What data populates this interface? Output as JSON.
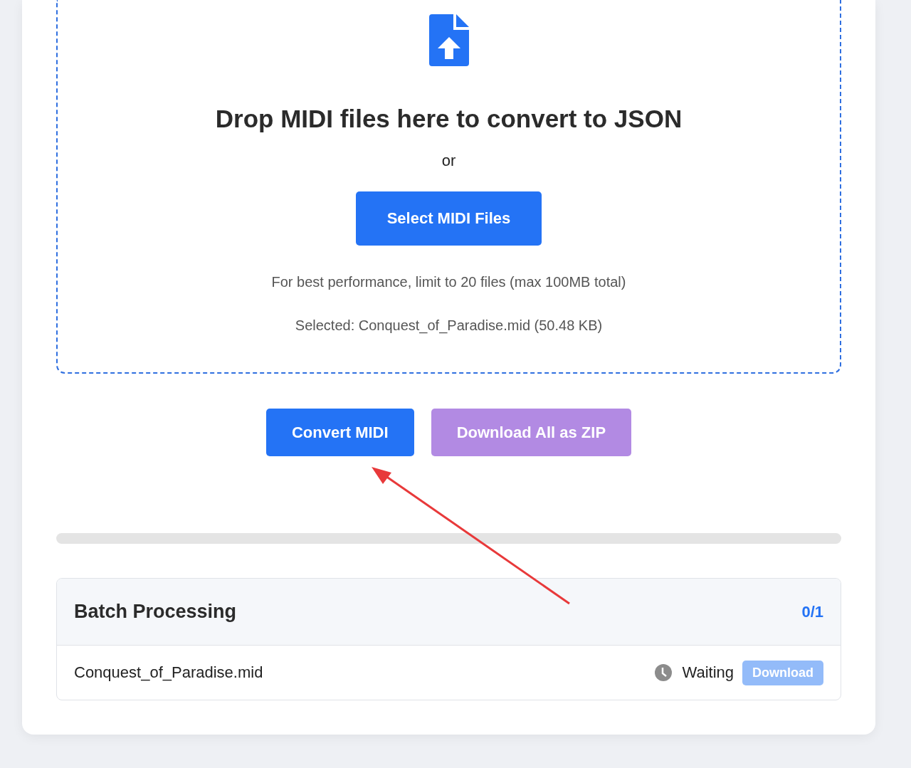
{
  "dropzone": {
    "title": "Drop MIDI files here to convert to JSON",
    "separator": "or",
    "select_button": "Select MIDI Files",
    "hint": "For best performance, limit to 20 files (max 100MB total)",
    "selected": "Selected: Conquest_of_Paradise.mid (50.48 KB)"
  },
  "actions": [
    {
      "label": "Convert MIDI",
      "kind": "primary",
      "disabled": false
    },
    {
      "label": "Download All as ZIP",
      "kind": "zip",
      "disabled": true
    }
  ],
  "batch": {
    "title": "Batch Processing",
    "count": "0/1",
    "files": [
      {
        "name": "Conquest_of_Paradise.mid",
        "status": "Waiting",
        "download": "Download",
        "disabled": true
      }
    ]
  }
}
